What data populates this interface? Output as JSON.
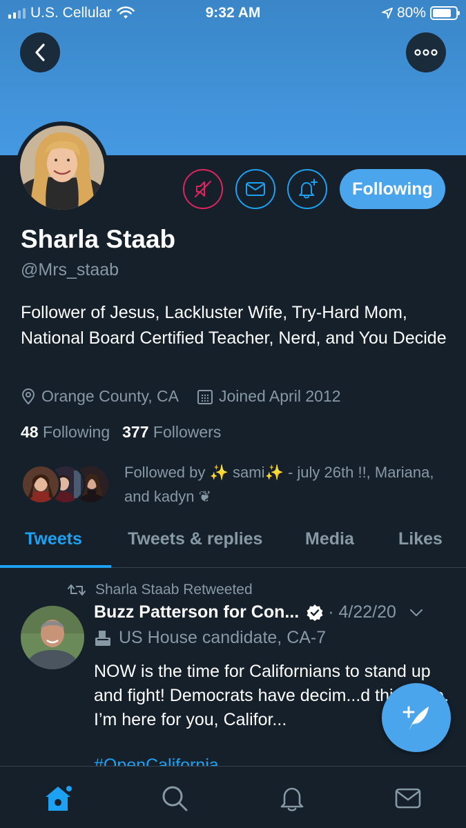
{
  "status_bar": {
    "carrier": "U.S. Cellular",
    "time": "9:32 AM",
    "battery": "80%",
    "battery_level": 0.8
  },
  "profile": {
    "name": "Sharla Staab",
    "handle": "@Mrs_staab",
    "bio": "Follower of Jesus, Lackluster Wife, Try-Hard Mom, National Board Certified Teacher, Nerd, and You Decide",
    "location": "Orange County, CA",
    "joined": "Joined April 2012",
    "following_count": "48",
    "following_label": "Following",
    "followers_count": "377",
    "followers_label": "Followers",
    "followed_by": "Followed by ✨ sami✨ - july 26th !!, Mariana, and kadyn ❦",
    "follow_button_label": "Following"
  },
  "tabs": [
    "Tweets",
    "Tweets & replies",
    "Media",
    "Likes"
  ],
  "active_tab": "Tweets",
  "tweet": {
    "retweeted_by": "Sharla Staab Retweeted",
    "author": "Buzz Patterson for Con...",
    "date": "· 4/22/20",
    "label": "US House candidate, CA-7",
    "text": "NOW is the time for Californians to stand up and fight! Democrats have decim...d this state. I’m here for you, Califor...",
    "hashtag": "#OpenCalifornia"
  },
  "icons": {
    "back": "chevron-left-icon",
    "more": "ellipsis-icon",
    "mute": "mute-icon",
    "message": "envelope-icon",
    "notify": "bell-plus-icon",
    "location": "location-pin-icon",
    "calendar": "calendar-icon",
    "retweet": "retweet-icon",
    "verified": "verified-badge-icon",
    "compose": "compose-tweet-icon",
    "nav": [
      "home-icon",
      "search-icon",
      "bell-icon",
      "envelope-icon"
    ]
  },
  "colors": {
    "background": "#15202b",
    "accent": "#1da1f2",
    "banner": "#4599e2",
    "mute_red": "#e0245e",
    "muted_text": "#8899a6"
  }
}
